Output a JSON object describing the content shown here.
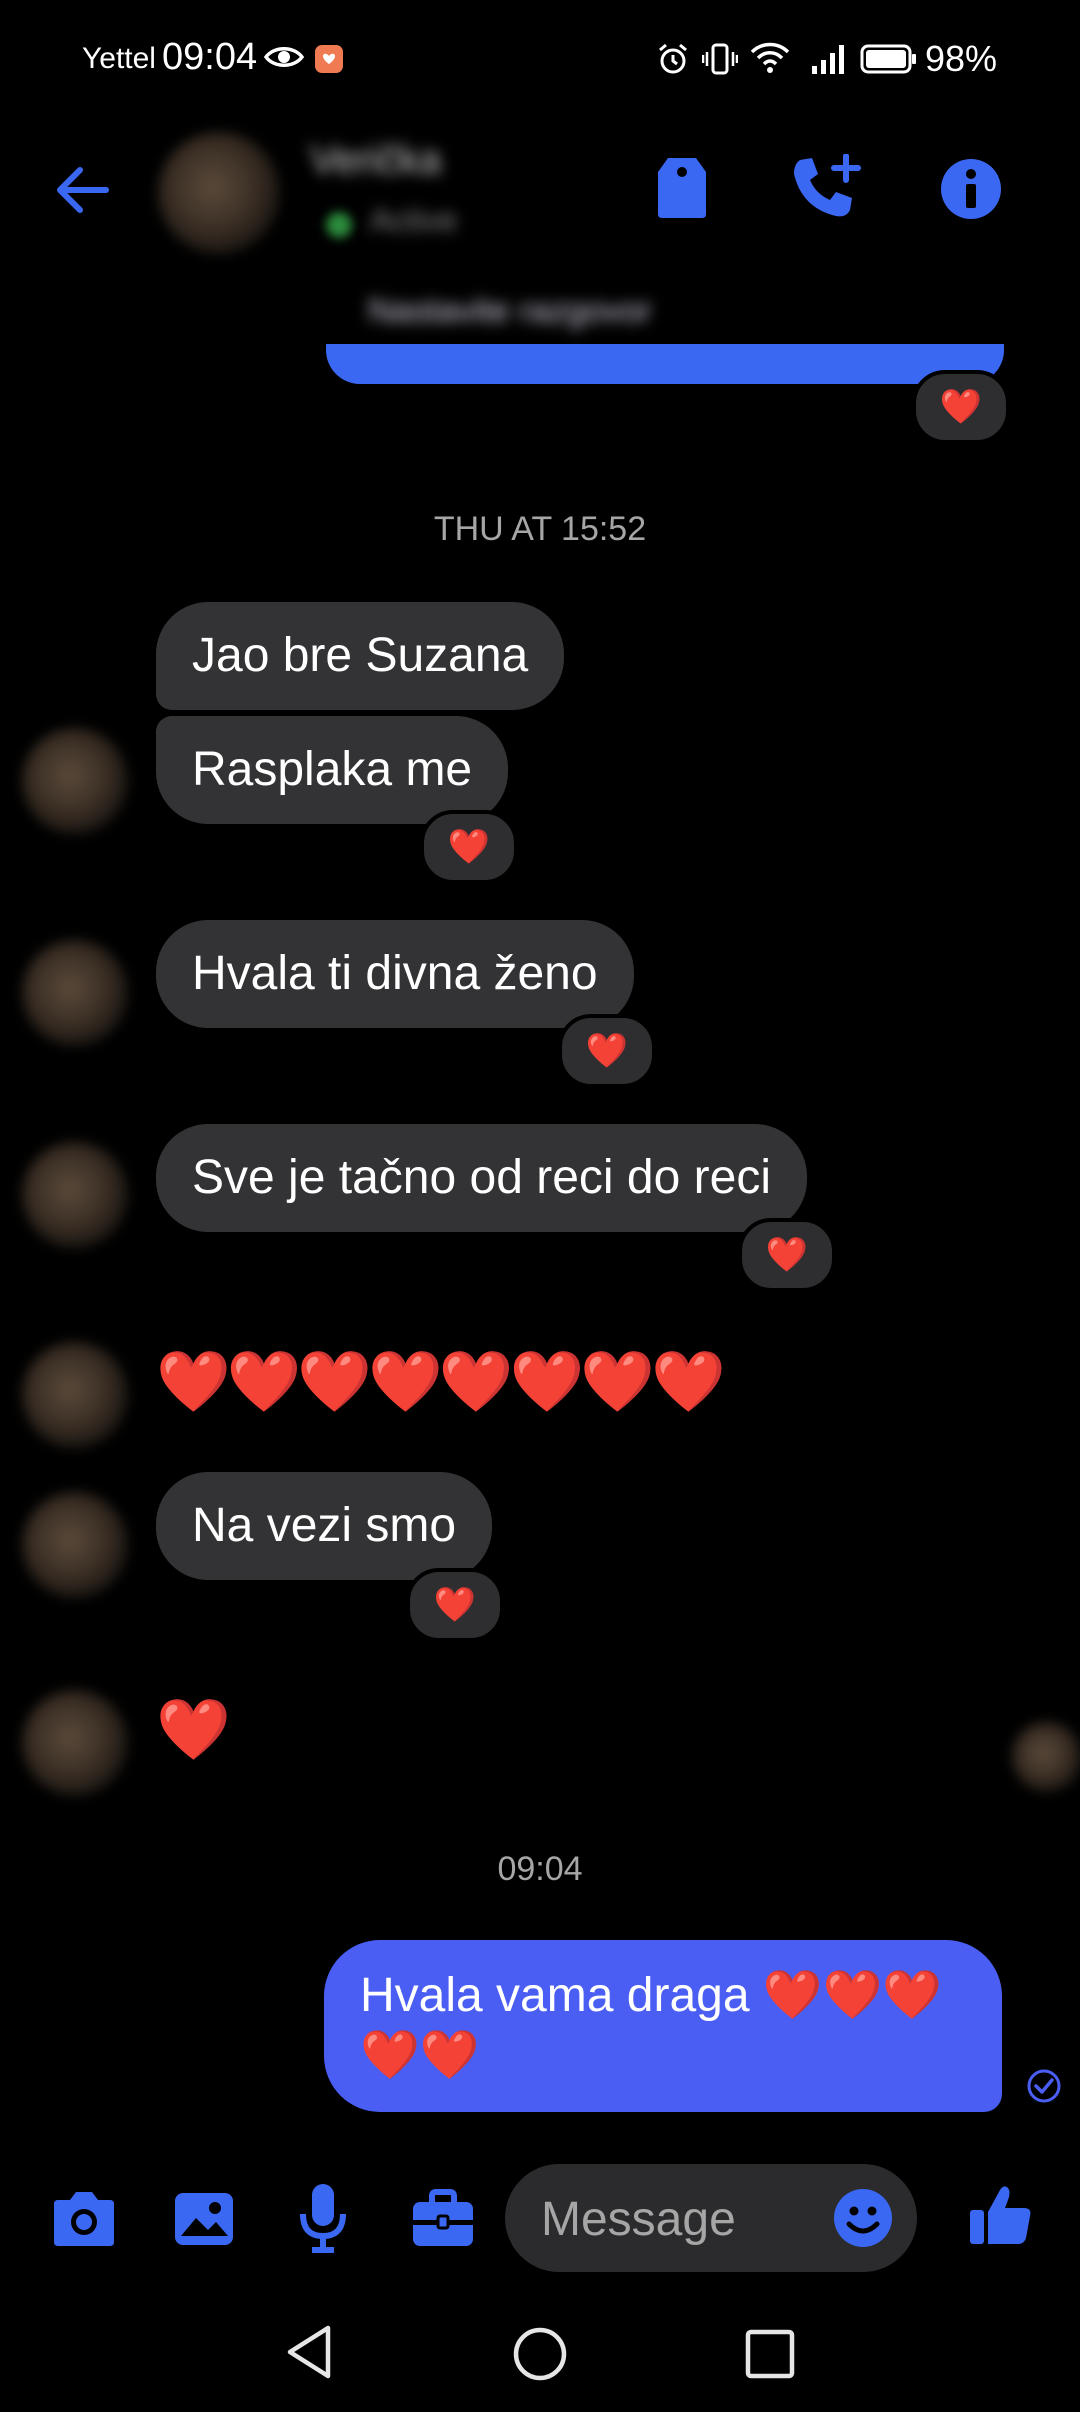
{
  "status_bar": {
    "carrier": "Yettel",
    "time": "09:04",
    "battery": "98%"
  },
  "header": {
    "contact_name": "Verička",
    "contact_status": "Active"
  },
  "pinned_preview": "Nastavite razgovor",
  "messages": {
    "timestamp_1": "THU AT 15:52",
    "msg_1": "Jao bre Suzana",
    "msg_2": "Rasplaka me",
    "msg_3": "Hvala ti divna ženo",
    "msg_4": "Sve je tačno od reci do reci",
    "msg_5": "❤️❤️❤️❤️❤️❤️❤️❤️",
    "msg_6": "Na vezi smo",
    "msg_7": "❤️",
    "timestamp_2": "09:04",
    "msg_out_1": "Hvala vama draga ❤️❤️❤️❤️❤️",
    "reaction": "❤️"
  },
  "composer": {
    "placeholder": "Message"
  },
  "colors": {
    "accent": "#3b68f3",
    "outgoing_bubble": "#4a5ef3",
    "incoming_bubble": "#333335"
  }
}
